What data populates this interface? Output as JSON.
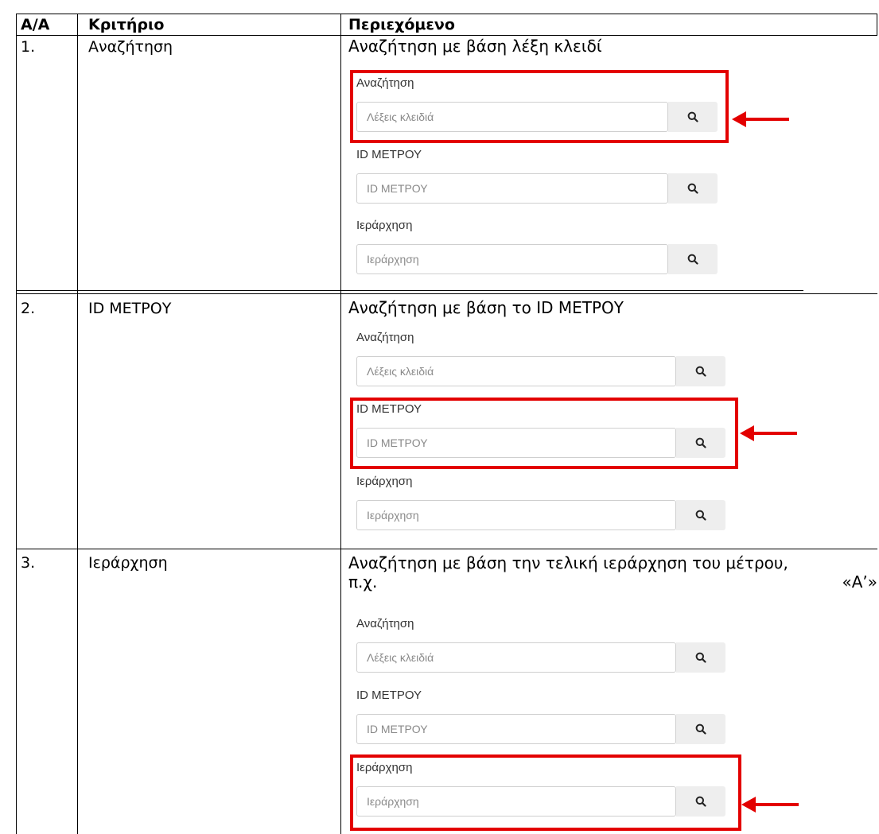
{
  "table": {
    "headers": [
      "Α/Α",
      "Κριτήριο",
      "Περιεχόμενο"
    ],
    "rows": [
      {
        "num": "1.",
        "criterion": "Αναζήτηση",
        "description": "Αναζήτηση με βάση λέξη κλειδί"
      },
      {
        "num": "2.",
        "criterion": "ID ΜΕΤΡΟΥ",
        "description": "Αναζήτηση με βάση το ID ΜΕΤΡΟΥ"
      },
      {
        "num": "3.",
        "criterion": "Ιεράρχηση",
        "description_line1": "Αναζήτηση με βάση την τελική ιεράρχηση του μέτρου,",
        "description_line2_left": "π.χ.",
        "description_line2_right": "«Α’»"
      }
    ]
  },
  "search_form": {
    "keyword_label": "Αναζήτηση",
    "keyword_placeholder": "Λέξεις κλειδιά",
    "id_label": "ID ΜΕΤΡΟΥ",
    "id_placeholder": "ID ΜΕΤΡΟΥ",
    "hierarchy_label": "Ιεράρχηση",
    "hierarchy_placeholder": "Ιεράρχηση"
  },
  "icons": {
    "search_button": "search-icon",
    "pointer": "arrow-left-icon"
  },
  "colors": {
    "highlight": "#e30000",
    "button_bg": "#eeeeee",
    "border": "#000000"
  }
}
